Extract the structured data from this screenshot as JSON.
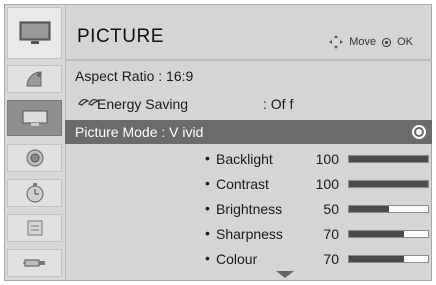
{
  "header": {
    "title": "PICTURE",
    "move_label": "Move",
    "ok_label": "OK"
  },
  "sidebar": {
    "items": [
      {
        "icon": "tv-icon"
      },
      {
        "icon": "antenna-icon"
      },
      {
        "icon": "picture-icon",
        "active": true
      },
      {
        "icon": "audio-icon"
      },
      {
        "icon": "clock-icon"
      },
      {
        "icon": "option-icon"
      },
      {
        "icon": "input-icon"
      }
    ]
  },
  "menu": {
    "aspect_ratio": "Aspect  Ratio   : 16:9",
    "energy_label": "Energy  Saving",
    "energy_value": ": Of f",
    "picture_mode": "Picture  Mode   :  V ivid"
  },
  "settings": [
    {
      "name": "Backlight",
      "value": "100",
      "level": 1.0
    },
    {
      "name": "Contrast",
      "value": "100",
      "level": 1.0
    },
    {
      "name": "Brightness",
      "value": "50",
      "level": 0.5
    },
    {
      "name": "Sharpness",
      "value": "70",
      "level": 0.7
    },
    {
      "name": "Colour",
      "value": "70",
      "level": 0.7
    }
  ],
  "bullet": "•"
}
